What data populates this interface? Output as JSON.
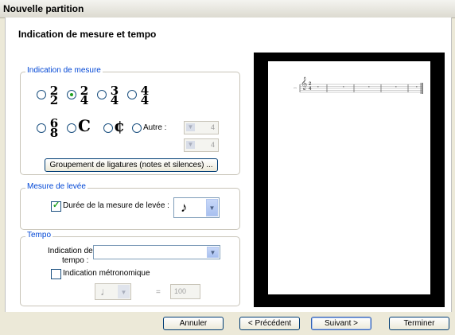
{
  "window": {
    "title": "Nouvelle partition"
  },
  "header": {
    "title": "Indication de mesure et tempo"
  },
  "time_signature": {
    "group_title": "Indication de mesure",
    "options_row1": [
      {
        "top": "2",
        "bottom": "2",
        "checked": false
      },
      {
        "top": "2",
        "bottom": "4",
        "checked": true
      },
      {
        "top": "3",
        "bottom": "4",
        "checked": false
      },
      {
        "top": "4",
        "bottom": "4",
        "checked": false
      }
    ],
    "options_row2": [
      {
        "top": "6",
        "bottom": "8"
      },
      {
        "symbol": "C"
      },
      {
        "symbol": "¢"
      }
    ],
    "other_label": "Autre :",
    "other_numerator": "4",
    "other_denominator": "4",
    "beam_button": "Groupement de ligatures (notes et silences) ..."
  },
  "pickup": {
    "group_title": "Mesure de levée",
    "checkbox_label": "Durée de la mesure de levée :",
    "checked": true,
    "note_value": "♪"
  },
  "tempo": {
    "group_title": "Tempo",
    "indication_label_line1": "Indication de",
    "indication_label_line2": "tempo :",
    "indication_value": "",
    "metronome_label": "Indication métronomique",
    "metronome_checked": false,
    "note_value": "♩",
    "equals": "=",
    "bpm": "100"
  },
  "preview": {
    "clef": "𝄞",
    "time_sig_top": "2",
    "time_sig_bottom": "4"
  },
  "footer": {
    "cancel": "Annuler",
    "previous": "< Précédent",
    "next": "Suivant >",
    "finish": "Terminer"
  },
  "icons": {
    "dropdown": "chevron-down-icon"
  }
}
